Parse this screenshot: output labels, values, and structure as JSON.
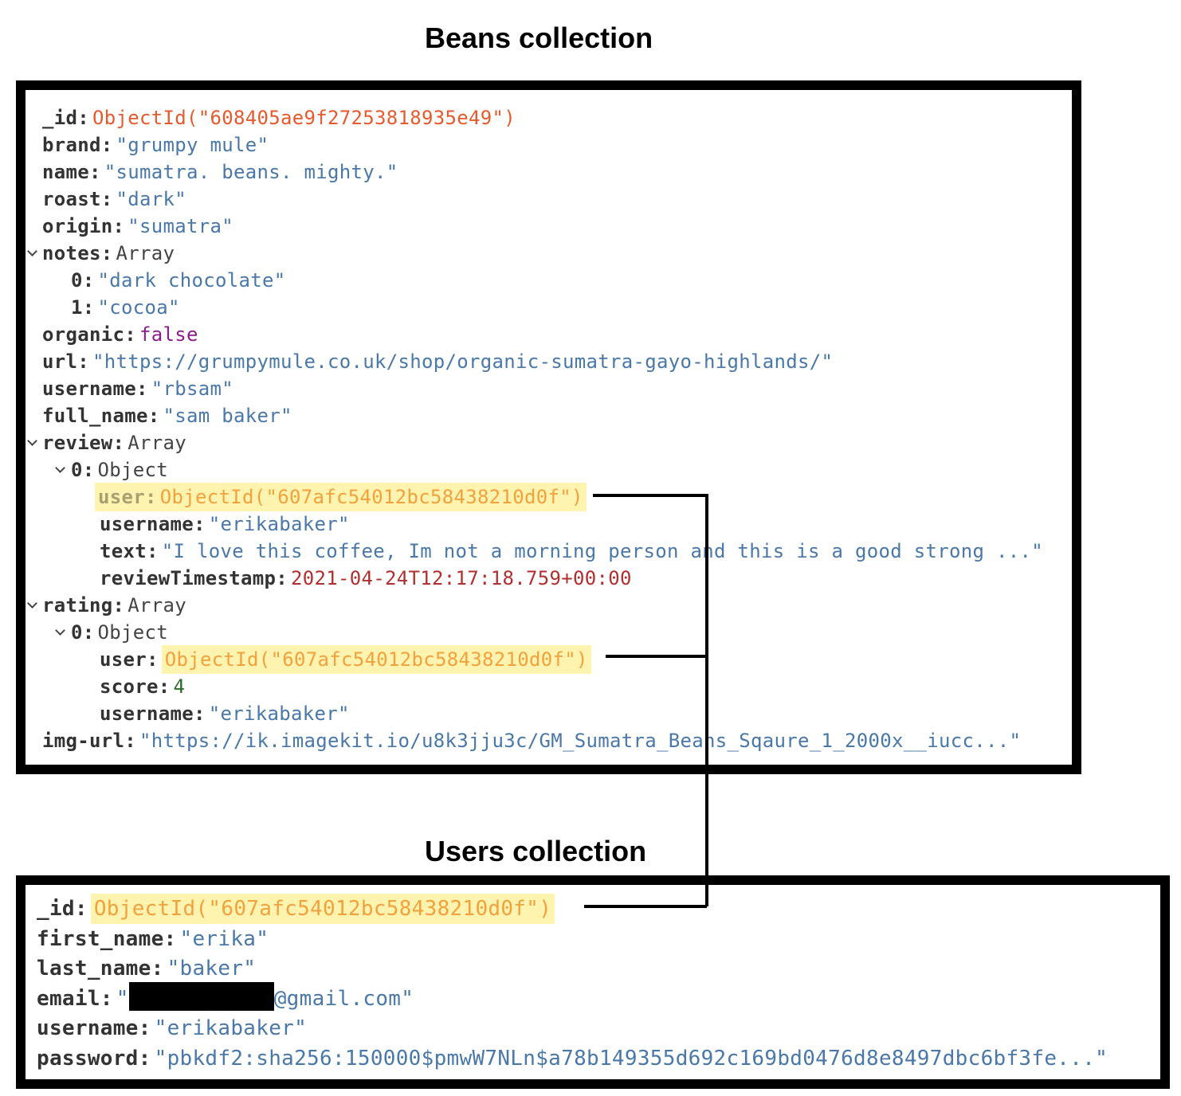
{
  "beans": {
    "title": "Beans collection",
    "rows": [
      {
        "key": "_id",
        "sep": ":",
        "value": "ObjectId(\"608405ae9f27253818935e49\")",
        "kind": "objectid"
      },
      {
        "key": "brand",
        "sep": ":",
        "value": "\"grumpy mule\"",
        "kind": "string"
      },
      {
        "key": "name",
        "sep": ":",
        "value": "\"sumatra. beans. mighty.\"",
        "kind": "string"
      },
      {
        "key": "roast",
        "sep": ":",
        "value": "\"dark\"",
        "kind": "string"
      },
      {
        "key": "origin",
        "sep": ":",
        "value": "\"sumatra\"",
        "kind": "string"
      },
      {
        "key": "notes",
        "sep": ":",
        "value": "Array",
        "kind": "type"
      },
      {
        "key": "0",
        "sep": ":",
        "value": "\"dark chocolate\"",
        "kind": "string"
      },
      {
        "key": "1",
        "sep": ":",
        "value": "\"cocoa\"",
        "kind": "string"
      },
      {
        "key": "organic",
        "sep": ":",
        "value": "false",
        "kind": "bool"
      },
      {
        "key": "url",
        "sep": ":",
        "value": "\"https://grumpymule.co.uk/shop/organic-sumatra-gayo-highlands/\"",
        "kind": "string"
      },
      {
        "key": "username",
        "sep": ":",
        "value": "\"rbsam\"",
        "kind": "string"
      },
      {
        "key": "full_name",
        "sep": ":",
        "value": "\"sam baker\"",
        "kind": "string"
      },
      {
        "key": "review",
        "sep": ":",
        "value": "Array",
        "kind": "type"
      },
      {
        "key": "0",
        "sep": ":",
        "value": "Object",
        "kind": "type"
      },
      {
        "key": "user",
        "sep": ":",
        "value": "ObjectId(\"607afc54012bc58438210d0f\")",
        "kind": "objectid"
      },
      {
        "key": "username",
        "sep": ":",
        "value": "\"erikabaker\"",
        "kind": "string"
      },
      {
        "key": "text",
        "sep": ":",
        "value": "\"I love this coffee, Im not a morning person and this is a good strong ...\"",
        "kind": "string"
      },
      {
        "key": "reviewTimestamp",
        "sep": ":",
        "value": "2021-04-24T12:17:18.759+00:00",
        "kind": "date"
      },
      {
        "key": "rating",
        "sep": ":",
        "value": "Array",
        "kind": "type"
      },
      {
        "key": "0",
        "sep": ":",
        "value": "Object",
        "kind": "type"
      },
      {
        "key": "user",
        "sep": ":",
        "value": "ObjectId(\"607afc54012bc58438210d0f\")",
        "kind": "objectid"
      },
      {
        "key": "score",
        "sep": ":",
        "value": "4",
        "kind": "number"
      },
      {
        "key": "username",
        "sep": ":",
        "value": "\"erikabaker\"",
        "kind": "string"
      },
      {
        "key": "img-url",
        "sep": ":",
        "value": "\"https://ik.imagekit.io/u8k3jju3c/GM_Sumatra_Beans_Sqaure_1_2000x__iucc...\"",
        "kind": "string"
      }
    ]
  },
  "users": {
    "title": "Users collection",
    "rows": [
      {
        "key": "_id",
        "sep": ":",
        "value": "ObjectId(\"607afc54012bc58438210d0f\")",
        "kind": "objectid"
      },
      {
        "key": "first_name",
        "sep": ":",
        "value": "\"erika\"",
        "kind": "string"
      },
      {
        "key": "last_name",
        "sep": ":",
        "value": "\"baker\"",
        "kind": "string"
      },
      {
        "key": "email",
        "sep": ":",
        "value_prefix": "\"",
        "value_suffix": "@gmail.com\"",
        "kind": "string"
      },
      {
        "key": "username",
        "sep": ":",
        "value": "\"erikabaker\"",
        "kind": "string"
      },
      {
        "key": "password",
        "sep": ":",
        "value": "\"pbkdf2:sha256:150000$pmwW7NLn$a78b149355d692c169bd0476d8e8497dbc6bf3fe...\"",
        "kind": "string"
      }
    ]
  },
  "colors": {
    "highlight": "#fff3b0",
    "objectid": "#e65a2e",
    "objectid_highlighted": "#f2a23c",
    "string": "#4a78a8",
    "bool": "#8a1e8a",
    "number": "#2b6e2b",
    "date": "#b03030",
    "border": "#000000"
  }
}
